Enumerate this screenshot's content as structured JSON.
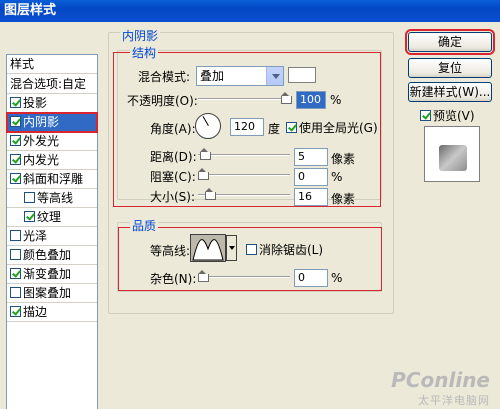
{
  "window": {
    "title": "图层样式"
  },
  "sidebar": {
    "header": "样式",
    "items": [
      {
        "label": "混合选项:自定",
        "checkbox": false,
        "checked": false,
        "indent": false,
        "selected": false
      },
      {
        "label": "投影",
        "checkbox": true,
        "checked": true,
        "indent": false,
        "selected": false
      },
      {
        "label": "内阴影",
        "checkbox": true,
        "checked": true,
        "indent": false,
        "selected": true
      },
      {
        "label": "外发光",
        "checkbox": true,
        "checked": true,
        "indent": false,
        "selected": false
      },
      {
        "label": "内发光",
        "checkbox": true,
        "checked": true,
        "indent": false,
        "selected": false
      },
      {
        "label": "斜面和浮雕",
        "checkbox": true,
        "checked": true,
        "indent": false,
        "selected": false
      },
      {
        "label": "等高线",
        "checkbox": true,
        "checked": false,
        "indent": true,
        "selected": false
      },
      {
        "label": "纹理",
        "checkbox": true,
        "checked": true,
        "indent": true,
        "selected": false
      },
      {
        "label": "光泽",
        "checkbox": true,
        "checked": false,
        "indent": false,
        "selected": false
      },
      {
        "label": "颜色叠加",
        "checkbox": true,
        "checked": false,
        "indent": false,
        "selected": false
      },
      {
        "label": "渐变叠加",
        "checkbox": true,
        "checked": true,
        "indent": false,
        "selected": false
      },
      {
        "label": "图案叠加",
        "checkbox": true,
        "checked": false,
        "indent": false,
        "selected": false
      },
      {
        "label": "描边",
        "checkbox": true,
        "checked": true,
        "indent": false,
        "selected": false
      }
    ]
  },
  "panel": {
    "title": "内阴影",
    "structure": {
      "legend": "结构",
      "blend_mode_label": "混合模式:",
      "blend_mode_value": "叠加",
      "opacity_label": "不透明度(O):",
      "opacity_value": "100",
      "opacity_unit": "%",
      "opacity_level": 1.0,
      "angle_label": "角度(A):",
      "angle_value": "120",
      "angle_unit": "度",
      "global_light_label": "使用全局光(G)",
      "global_light_checked": true,
      "distance_label": "距离(D):",
      "distance_value": "5",
      "distance_unit": "像素",
      "choke_label": "阻塞(C):",
      "choke_value": "0",
      "choke_unit": "%",
      "size_label": "大小(S):",
      "size_value": "16",
      "size_unit": "像素"
    },
    "quality": {
      "legend": "品质",
      "contour_label": "等高线:",
      "antialias_label": "消除锯齿(L)",
      "antialias_checked": false,
      "noise_label": "杂色(N):",
      "noise_value": "0",
      "noise_unit": "%"
    }
  },
  "buttons": {
    "ok": "确定",
    "reset": "复位",
    "new_style": "新建样式(W)...",
    "preview_label": "预览(V)",
    "preview_checked": true
  },
  "watermark": {
    "line1": "PConline",
    "line2": "太平洋电脑网"
  },
  "colors": {
    "accent": "#0046d5",
    "highlight": "#316ac5",
    "annotation_red": "#d9252f"
  }
}
